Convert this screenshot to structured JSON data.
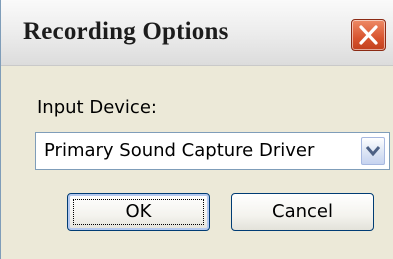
{
  "dialog": {
    "title": "Recording Options",
    "close_icon": "close-x-icon",
    "close_color": "#d8542f"
  },
  "form": {
    "input_device_label": "Input Device:",
    "input_device_value": "Primary Sound Capture Driver",
    "dropdown_icon": "chevron-down-icon"
  },
  "buttons": {
    "ok_label": "OK",
    "cancel_label": "Cancel"
  }
}
